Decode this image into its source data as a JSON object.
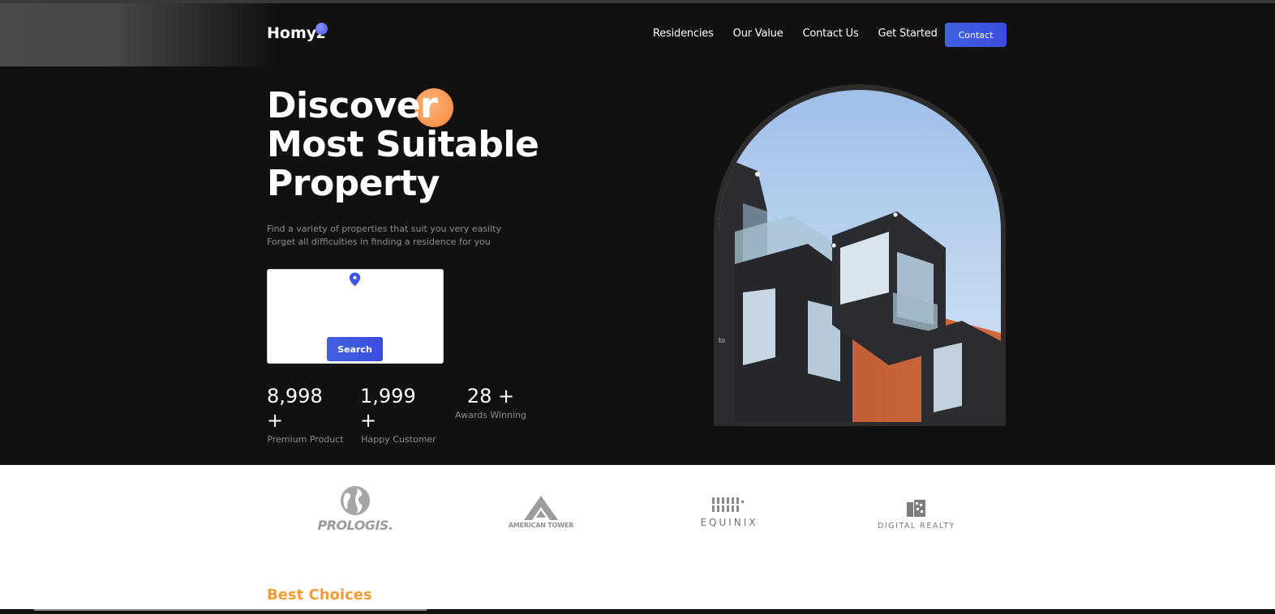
{
  "header": {
    "logo": "Homyz",
    "nav": [
      {
        "label": "Residencies"
      },
      {
        "label": "Our Value"
      },
      {
        "label": "Contact Us"
      },
      {
        "label": "Get Started"
      }
    ],
    "contact_label": "Contact"
  },
  "hero": {
    "title_lines": [
      "Discover",
      "Most Suitable",
      "Property"
    ],
    "subtitle_lines": [
      "Find a variety of properties that suit you very easilty",
      "Forget all difficulties in finding a residence for you"
    ],
    "search_label": "Search",
    "search_icon": "location-pin-icon",
    "image_alt_text": "to",
    "stats": [
      {
        "value": "8,998 +",
        "label": "Premium Product"
      },
      {
        "value": "1,999 +",
        "label": "Happy Customer"
      },
      {
        "value": "28 +",
        "label": "Awards Winning"
      }
    ]
  },
  "companies": [
    {
      "name": "PROLOGIS."
    },
    {
      "name": "AMERICAN TOWER"
    },
    {
      "name": "EQUINIX"
    },
    {
      "name": "DIGITAL REALTY"
    }
  ],
  "section": {
    "title": "Best Choices"
  },
  "colors": {
    "background": "#131110",
    "accent_blue": "#4161df",
    "accent_orange": "#f5883c",
    "best_choices": "#f39c33"
  }
}
